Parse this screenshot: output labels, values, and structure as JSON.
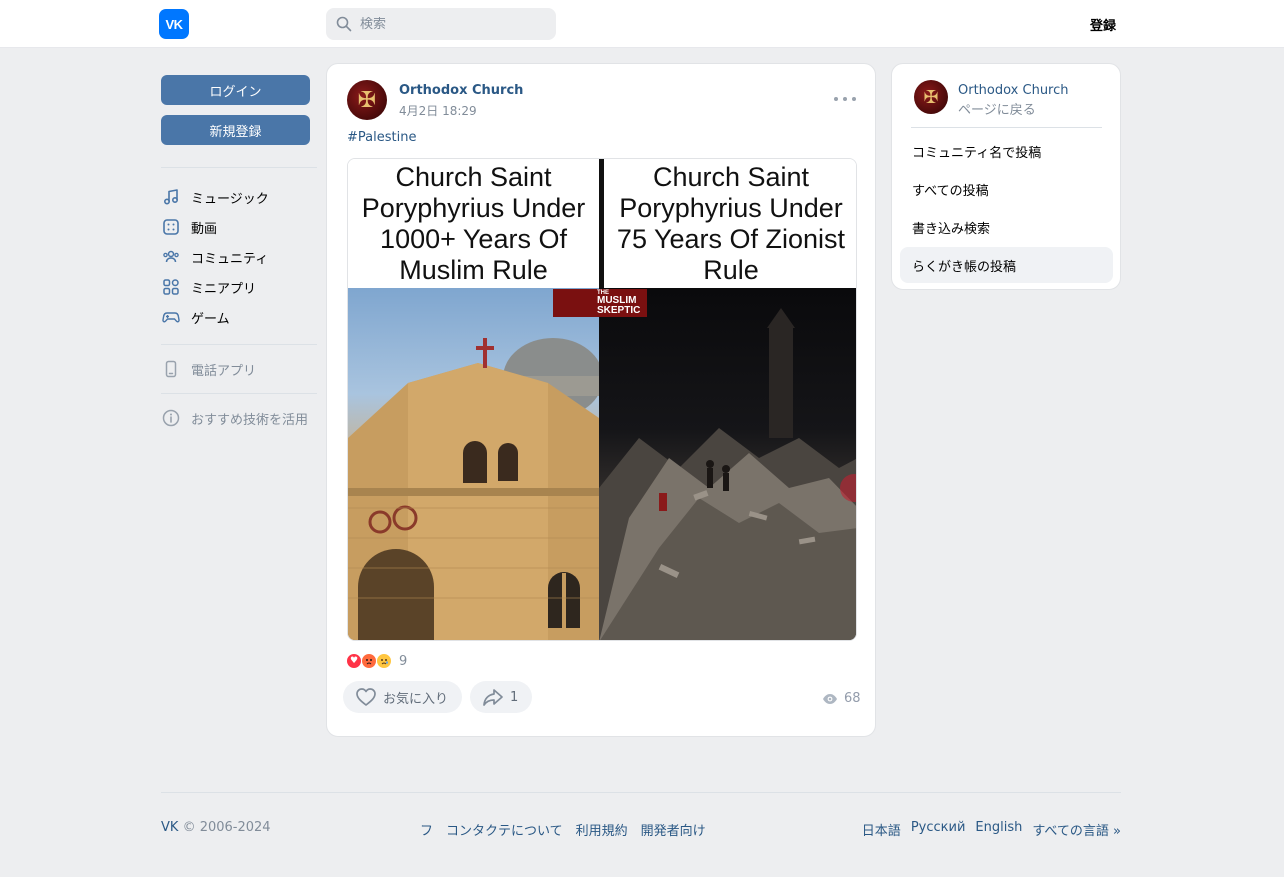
{
  "header": {
    "logo_text": "VK",
    "search_placeholder": "検索",
    "register_label": "登録"
  },
  "sidebar": {
    "login_label": "ログイン",
    "signup_label": "新規登録",
    "items": [
      {
        "label": "ミュージック",
        "icon": "music-icon"
      },
      {
        "label": "動画",
        "icon": "video-icon"
      },
      {
        "label": "コミュニティ",
        "icon": "community-icon"
      },
      {
        "label": "ミニアプリ",
        "icon": "mini-apps-icon"
      },
      {
        "label": "ゲーム",
        "icon": "gamepad-icon"
      }
    ],
    "phone_app_label": "電話アプリ",
    "recommend_label": "おすすめ技術を活用"
  },
  "post": {
    "author": "Orthodox Church",
    "date": "4月2日 18:29",
    "hashtag": "#Palestine",
    "image": {
      "left_caption": "Church Saint Poryphyrius Under 1000+ Years Of Muslim Rule",
      "right_caption": "Church Saint Poryphyrius Under 75 Years Of Zionist Rule",
      "watermark_line1": "THE",
      "watermark_line2": "MUSLIM",
      "watermark_line3": "SKEPTIC"
    },
    "reaction_count": "9",
    "like_label": "お気に入り",
    "share_count": "1",
    "views": "68"
  },
  "right_panel": {
    "author": "Orthodox Church",
    "back_label": "ページに戻る",
    "items": [
      {
        "label": "コミュニティ名で投稿"
      },
      {
        "label": "すべての投稿"
      },
      {
        "label": "書き込み検索"
      },
      {
        "label": "らくがき帳の投稿"
      }
    ]
  },
  "footer": {
    "brand": "VK",
    "copyright": "© 2006-2024",
    "links": [
      "フ",
      "コンタクテについて",
      "利用規約",
      "開発者向け"
    ],
    "languages": [
      "日本語",
      "Русский",
      "English",
      "すべての言語 »"
    ]
  },
  "colors": {
    "brand_blue": "#0077ff",
    "button_blue": "#4a76a8",
    "link_blue": "#2a5885",
    "background": "#edeef0"
  }
}
